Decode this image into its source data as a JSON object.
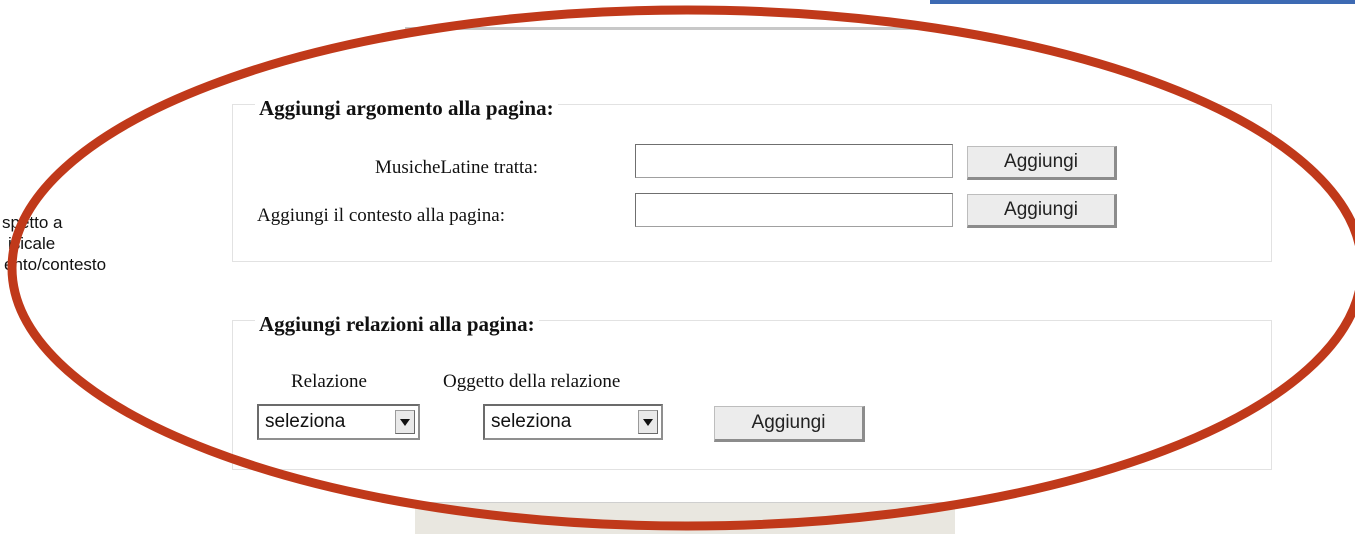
{
  "side_text": {
    "line1": "spetto a",
    "line2": "isicale",
    "line3": "ento/contesto"
  },
  "topic_section": {
    "legend": "Aggiungi argomento alla pagina:",
    "row1_label": "MusicheLatine tratta:",
    "row1_value": "",
    "row1_button": "Aggiungi",
    "row2_label": "Aggiungi il contesto alla pagina:",
    "row2_value": "",
    "row2_button": "Aggiungi"
  },
  "relation_section": {
    "legend": "Aggiungi relazioni alla pagina:",
    "relation_header": "Relazione",
    "object_header": "Oggetto della relazione",
    "relation_select": "seleziona",
    "object_select": "seleziona",
    "button": "Aggiungi"
  },
  "colors": {
    "annotation_ellipse": "#c0391a",
    "top_accent": "#3d6ab3"
  },
  "icons": {
    "dropdown": "chevron-down-icon"
  }
}
